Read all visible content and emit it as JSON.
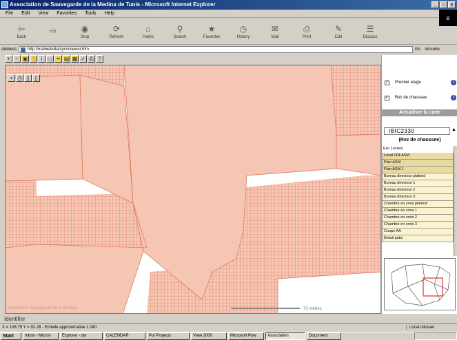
{
  "window": {
    "title": "Association de Sauvegarde de la Medina de Tunis - Microsoft Internet Explorer"
  },
  "menu": [
    "File",
    "Edit",
    "View",
    "Favorites",
    "Tools",
    "Help"
  ],
  "toolbar": [
    {
      "label": "Back",
      "icon": "back-arrow-icon"
    },
    {
      "label": "",
      "icon": "forward-arrow-icon"
    },
    {
      "label": "Stop",
      "icon": "stop-icon"
    },
    {
      "label": "Refresh",
      "icon": "refresh-icon"
    },
    {
      "label": "Home",
      "icon": "home-icon"
    },
    {
      "label": "Search",
      "icon": "search-icon"
    },
    {
      "label": "Favorites",
      "icon": "favorites-icon"
    },
    {
      "label": "History",
      "icon": "history-icon"
    },
    {
      "label": "Mail",
      "icon": "mail-icon"
    },
    {
      "label": "Print",
      "icon": "print-icon"
    },
    {
      "label": "Edit",
      "icon": "edit-icon"
    },
    {
      "label": "Discuss",
      "icon": "discuss-icon"
    }
  ],
  "address": {
    "label": "Address",
    "url": "http://malwebsite/sysv/viewer.htm",
    "go_label": "Go",
    "links_label": "Vinculos"
  },
  "layers": [
    {
      "label": "Premier etage",
      "checked": true
    },
    {
      "label": "Rez de chaussee",
      "checked": true
    }
  ],
  "refresh_map_label": "Actualiser la carte",
  "building_id": "IBIC2330",
  "floor_label": "(Rez de chaussee)",
  "rooms": [
    "Esc Luciani",
    "Local 004 ASM",
    "Plan ASM",
    "Plan ASM 1",
    "Bureau directeur plafond",
    "Bureau directeur 1",
    "Bureau directeur 2",
    "Bureau directeur 3",
    "Chambre en croix plafond",
    "Chambre en croix 1",
    "Chambre en croix 2",
    "Chambre en croix 3",
    "Coupe AA",
    "Detail patio"
  ],
  "map": {
    "credit": "Association Sauvegarde de la Medina",
    "scale_label": "70 mètres",
    "parcel_color": "#f6c6b4",
    "stroke_color": "#d96f52"
  },
  "status_identifier": "Identifier",
  "status_text": "X = 108.75  Y = 92.28 - Echelle approximative 1:240",
  "status_zone": "Local intranet",
  "taskbar": {
    "start": "Start",
    "tasks": [
      "Inbox - Micros",
      "Explorer - dw",
      "CALENDAR",
      "Pol Projects",
      "View 2000",
      "Microsoft Pow",
      "Association",
      "Document"
    ]
  }
}
